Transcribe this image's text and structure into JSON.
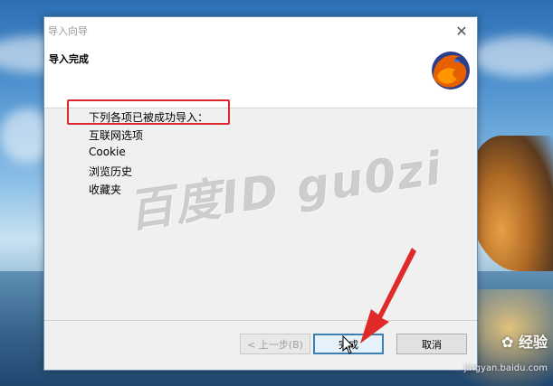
{
  "dialog": {
    "title": "导入向导",
    "header_title": "导入完成",
    "message": "下列各项已被成功导入：",
    "items": [
      "互联网选项",
      "Cookie",
      "浏览历史",
      "收藏夹"
    ],
    "buttons": {
      "back": "< 上一步(B)",
      "finish": "完成",
      "cancel": "取消"
    }
  },
  "overlay": {
    "watermark": "百度ID  gu0zi",
    "site_logo": "经验",
    "site_url": "jingyan.baidu.com"
  },
  "icons": {
    "close": "close-icon",
    "logo": "firefox-logo-icon",
    "arrow": "red-arrow-icon",
    "cursor": "mouse-cursor-icon"
  },
  "colors": {
    "highlight": "#d8282e",
    "primary_button_border": "#3c7fb1"
  }
}
